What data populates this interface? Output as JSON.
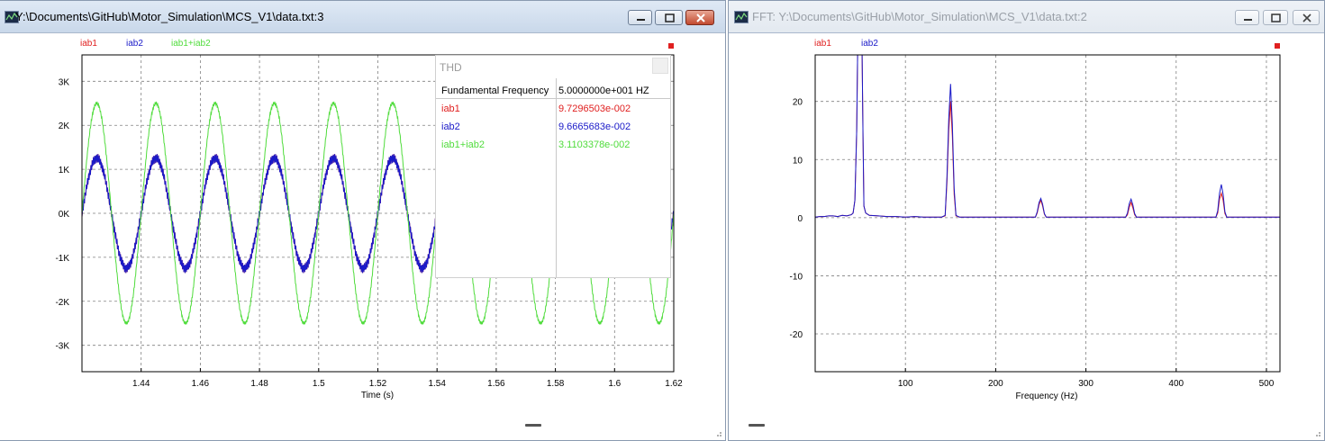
{
  "windows": {
    "time": {
      "title": "Y:\\Documents\\GitHub\\Motor_Simulation\\MCS_V1\\data.txt:3",
      "legend": [
        {
          "label": "iab1",
          "color": "#e02020"
        },
        {
          "label": "iab2",
          "color": "#1a1ac8"
        },
        {
          "label": "iab1+iab2",
          "color": "#50dc3c"
        }
      ],
      "xlabel": "Time (s)"
    },
    "fft": {
      "title": "FFT:  Y:\\Documents\\GitHub\\Motor_Simulation\\MCS_V1\\data.txt:2",
      "legend": [
        {
          "label": "iab1",
          "color": "#e02020"
        },
        {
          "label": "iab2",
          "color": "#1a1ac8"
        }
      ],
      "xlabel": "Frequency (Hz)"
    }
  },
  "thd": {
    "title": "THD",
    "fundamental_label": "Fundamental Frequency",
    "fundamental_value": "5.0000000e+001 HZ",
    "rows": [
      {
        "name": "iab1",
        "value": "9.7296503e-002",
        "color": "#e02020"
      },
      {
        "name": "iab2",
        "value": "9.6665683e-002",
        "color": "#1a1ac8"
      },
      {
        "name": "iab1+iab2",
        "value": "3.1103378e-002",
        "color": "#50dc3c"
      }
    ]
  },
  "chart_data": [
    {
      "type": "line",
      "xlabel": "Time (s)",
      "xlim": [
        1.42,
        1.62
      ],
      "ylim": [
        -3600,
        3600
      ],
      "xticks": [
        1.44,
        1.46,
        1.48,
        1.5,
        1.52,
        1.54,
        1.56,
        1.58,
        1.6,
        1.62
      ],
      "xtick_labels": [
        "1.44",
        "1.46",
        "1.48",
        "1.5",
        "1.52",
        "1.54",
        "1.56",
        "1.58",
        "1.6",
        "1.62"
      ],
      "yticks": [
        3000,
        2000,
        1000,
        0,
        -1000,
        -2000,
        -3000
      ],
      "ytick_labels": [
        "3K",
        "2K",
        "1K",
        "0K",
        "-1K",
        "-2K",
        "-3K"
      ],
      "grid": true,
      "legend_position": "top-left",
      "series": [
        {
          "name": "iab1",
          "color": "#e02020",
          "frequency_hz": 50,
          "amplitude": 1250,
          "ripple": 110
        },
        {
          "name": "iab2",
          "color": "#1a1ac8",
          "frequency_hz": 50,
          "amplitude": 1250,
          "ripple": 110
        },
        {
          "name": "iab1+iab2",
          "color": "#50dc3c",
          "frequency_hz": 50,
          "amplitude": 2500,
          "ripple": 40
        }
      ]
    },
    {
      "type": "line",
      "xlabel": "Frequency (Hz)",
      "xlim": [
        0,
        515
      ],
      "ylim": [
        -26.5,
        28
      ],
      "xticks": [
        100,
        200,
        300,
        400,
        500
      ],
      "xtick_labels": [
        "100",
        "200",
        "300",
        "400",
        "500"
      ],
      "yticks": [
        20,
        10,
        0,
        -10,
        -20
      ],
      "ytick_labels": [
        "20",
        "10",
        "0",
        "-10",
        "-20"
      ],
      "grid": true,
      "legend_position": "top-left",
      "series": [
        {
          "name": "iab1",
          "color": "#e02020",
          "x": [
            0,
            5,
            10,
            15,
            20,
            25,
            30,
            35,
            40,
            42,
            44,
            46,
            47,
            52,
            53,
            54,
            56,
            60,
            70,
            80,
            90,
            100,
            110,
            120,
            130,
            140,
            144,
            146,
            148,
            150,
            152,
            154,
            156,
            160,
            200,
            244,
            246,
            248,
            250,
            252,
            254,
            256,
            300,
            344,
            346,
            348,
            350,
            352,
            354,
            356,
            400,
            444,
            446,
            448,
            450,
            452,
            454,
            456,
            515
          ],
          "y": [
            0.1,
            0.2,
            0.2,
            0.3,
            0.3,
            0.2,
            0.4,
            0.3,
            0.5,
            0.8,
            3,
            15,
            28,
            28,
            14,
            2,
            0.8,
            0.4,
            0.3,
            0.2,
            0.2,
            0.1,
            0.2,
            0.1,
            0.1,
            0.1,
            0.3,
            6,
            15,
            20,
            14,
            4,
            0.3,
            0.1,
            0.1,
            0.1,
            0.8,
            2.2,
            3.0,
            2.0,
            0.6,
            0.1,
            0.1,
            0.1,
            0.5,
            1.8,
            2.6,
            1.7,
            0.5,
            0.1,
            0.1,
            0.1,
            0.8,
            3.2,
            4.2,
            3.0,
            0.7,
            0.1,
            0.1
          ]
        },
        {
          "name": "iab2",
          "color": "#1a1ac8",
          "x": [
            0,
            5,
            10,
            15,
            20,
            25,
            30,
            35,
            40,
            42,
            44,
            46,
            47,
            52,
            53,
            54,
            56,
            60,
            70,
            80,
            90,
            100,
            110,
            120,
            130,
            140,
            144,
            146,
            148,
            150,
            152,
            154,
            156,
            160,
            200,
            244,
            246,
            248,
            250,
            252,
            254,
            256,
            300,
            344,
            346,
            348,
            350,
            352,
            354,
            356,
            400,
            444,
            446,
            448,
            450,
            452,
            454,
            456,
            515
          ],
          "y": [
            0.1,
            0.2,
            0.2,
            0.3,
            0.3,
            0.2,
            0.4,
            0.3,
            0.5,
            0.8,
            3,
            15,
            28,
            28,
            14,
            2,
            0.8,
            0.4,
            0.3,
            0.2,
            0.2,
            0.1,
            0.2,
            0.1,
            0.1,
            0.1,
            0.4,
            7,
            17,
            23,
            16,
            5,
            0.4,
            0.1,
            0.1,
            0.1,
            1.0,
            2.6,
            3.3,
            2.3,
            0.7,
            0.1,
            0.1,
            0.1,
            0.8,
            2.4,
            3.2,
            2.2,
            0.7,
            0.1,
            0.1,
            0.1,
            1.2,
            4.2,
            5.7,
            4.0,
            1.0,
            0.1,
            0.1
          ]
        }
      ]
    }
  ]
}
